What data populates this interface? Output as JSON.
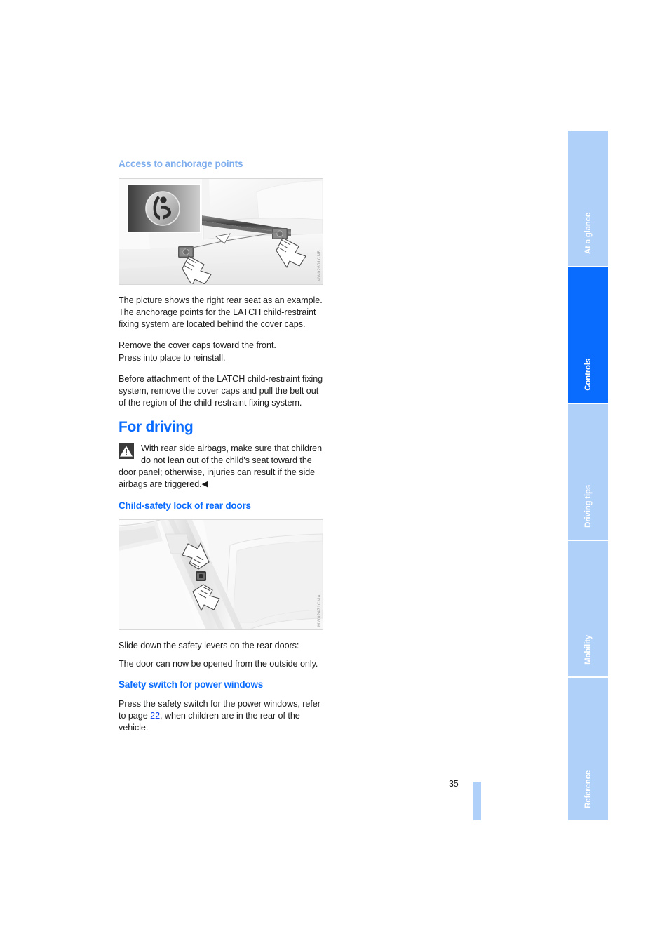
{
  "document": {
    "page_number": "35"
  },
  "content": {
    "section_anchorage_heading": "Access to anchorage points",
    "figure_anchorage_code": "MW02601CNB",
    "paragraph_1": "The picture shows the right rear seat as an example. The anchorage points for the LATCH child-restraint fixing system are located behind the cover caps.",
    "paragraph_2": "Remove the cover caps toward the front.",
    "paragraph_3": "Press into place to reinstall.",
    "paragraph_4": "Before attachment of the LATCH child-restraint fixing system, remove the cover caps and pull the belt out of the region of the child-restraint fixing system.",
    "chapter_heading": "For driving",
    "warning_text": "With rear side airbags, make sure that children do not lean out of the child's seat toward the door panel; otherwise, injuries can result if the side airbags are triggered.",
    "warning_end_marker": "◀",
    "section_childlock_heading": "Child-safety lock of rear doors",
    "figure_childlock_code": "MW02471CMA",
    "paragraph_5": "Slide down the safety levers on the rear doors:",
    "paragraph_6": "The door can now be opened from the outside only.",
    "section_powerwindows_heading": "Safety switch for power windows",
    "paragraph_7_before": "Press the safety switch for the power windows, refer to page ",
    "paragraph_7_link": "22",
    "paragraph_7_after": ", when children are in the rear of the vehicle."
  },
  "tabs": [
    {
      "label": "At a glance",
      "active": false
    },
    {
      "label": "Controls",
      "active": true
    },
    {
      "label": "Driving tips",
      "active": false
    },
    {
      "label": "Mobility",
      "active": false
    },
    {
      "label": "Reference",
      "active": false
    }
  ],
  "colors": {
    "accent_blue": "#0A6CFF",
    "light_blue": "#AFD0F9",
    "heading_light_blue": "#7FAEEE",
    "link_blue": "#1144EE"
  }
}
